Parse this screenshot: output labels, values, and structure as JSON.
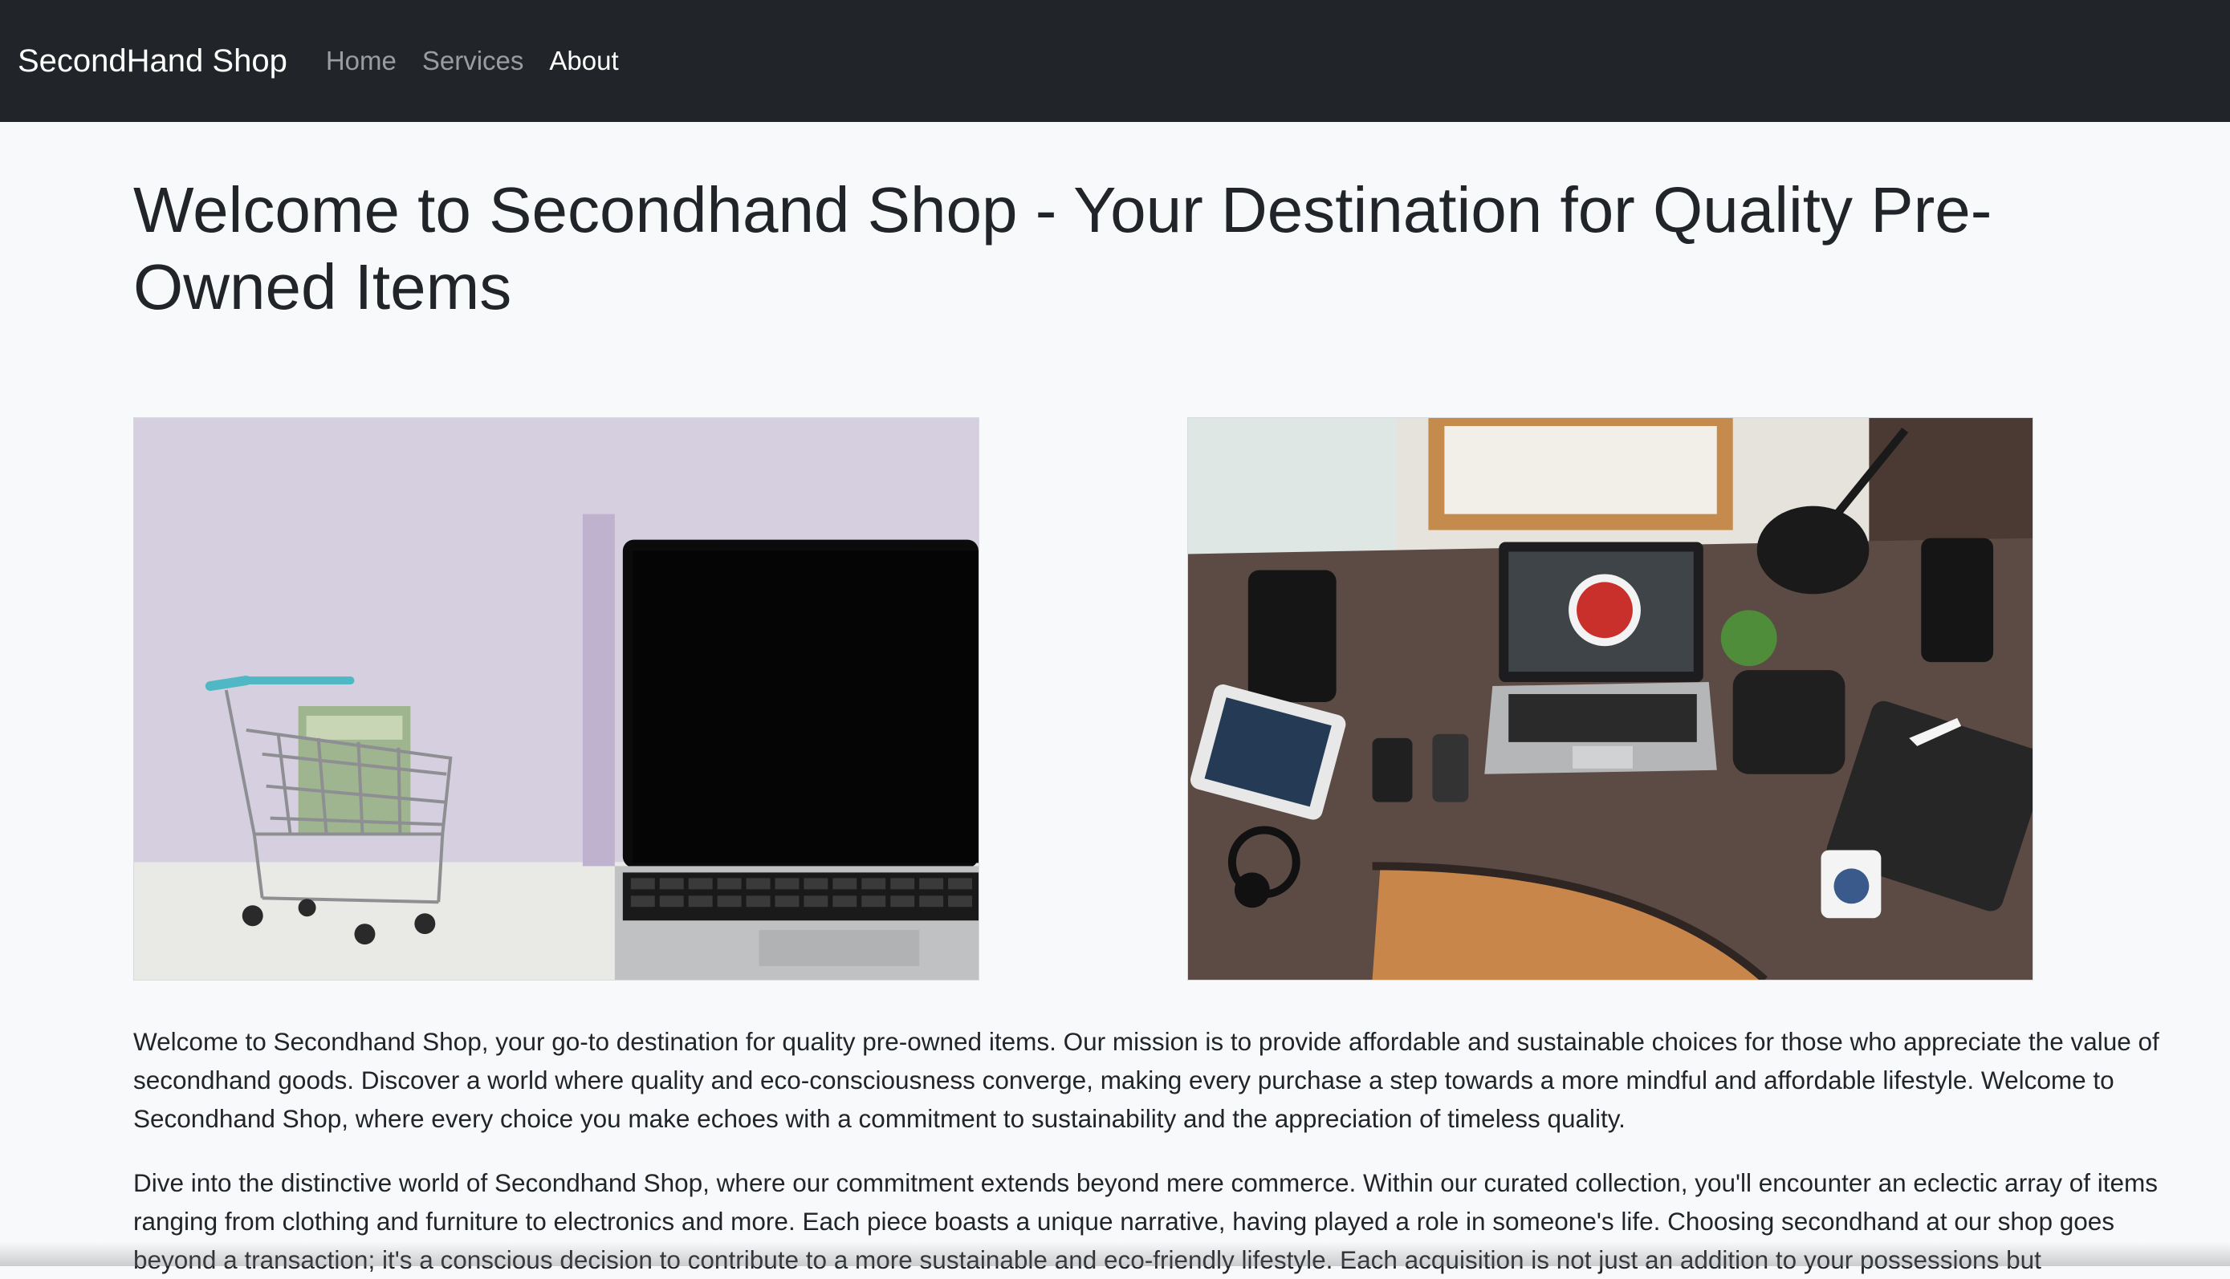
{
  "navbar": {
    "brand": "SecondHand Shop",
    "links": [
      {
        "label": "Home",
        "active": false
      },
      {
        "label": "Services",
        "active": false
      },
      {
        "label": "About",
        "active": true
      }
    ]
  },
  "main": {
    "title": "Welcome to Secondhand Shop - Your Destination for Quality Pre-Owned Items",
    "images": [
      {
        "icon": "shopping-cart-laptop-photo"
      },
      {
        "icon": "desk-workspace-photo"
      }
    ],
    "paragraphs": [
      "Welcome to Secondhand Shop, your go-to destination for quality pre-owned items. Our mission is to provide affordable and sustainable choices for those who appreciate the value of secondhand goods. Discover a world where quality and eco-consciousness converge, making every purchase a step towards a more mindful and affordable lifestyle. Welcome to Secondhand Shop, where every choice you make echoes with a commitment to sustainability and the appreciation of timeless quality.",
      "Dive into the distinctive world of Secondhand Shop, where our commitment extends beyond mere commerce. Within our curated collection, you'll encounter an eclectic array of items ranging from clothing and furniture to electronics and more. Each piece boasts a unique narrative, having played a role in someone's life. Choosing secondhand at our shop goes beyond a transaction; it's a conscious decision to contribute to a more sustainable and eco-friendly lifestyle. Each acquisition is not just an addition to your possessions but"
    ]
  },
  "colors": {
    "navbar_bg": "#212529",
    "page_bg": "#f8f9fb",
    "text": "#212529",
    "nav_inactive": "#9a9da1",
    "nav_active": "#ffffff"
  }
}
